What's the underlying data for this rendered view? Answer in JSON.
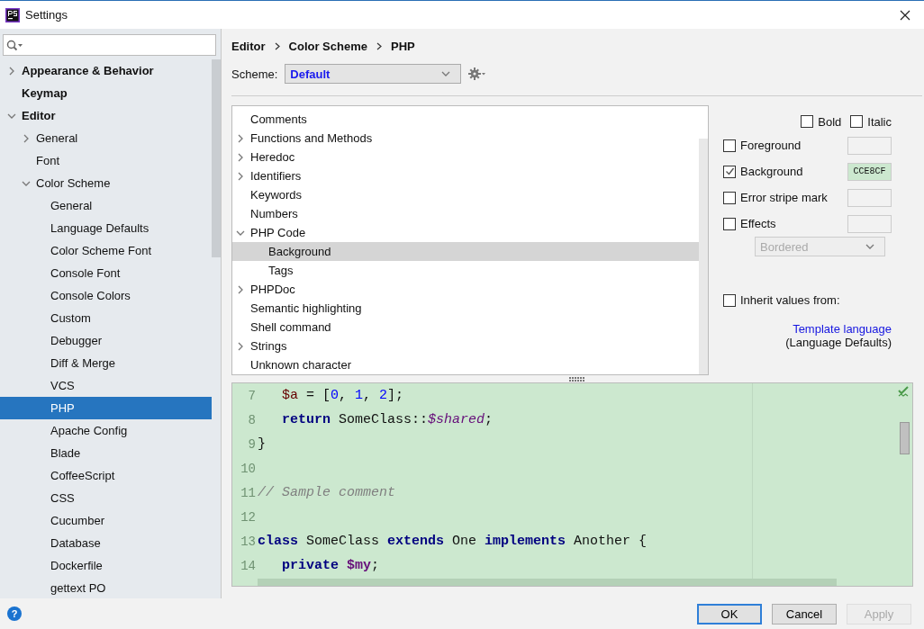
{
  "window": {
    "title": "Settings"
  },
  "sidebar": {
    "items": [
      {
        "label": "Appearance & Behavior",
        "expanded": false,
        "selected": false
      },
      {
        "label": "Keymap",
        "selected": false
      },
      {
        "label": "Editor",
        "expanded": true,
        "selected": false,
        "children": [
          {
            "label": "General",
            "expanded": false,
            "selected": false
          },
          {
            "label": "Font",
            "selected": false
          },
          {
            "label": "Color Scheme",
            "expanded": true,
            "selected": false,
            "children": [
              {
                "label": "General",
                "selected": false
              },
              {
                "label": "Language Defaults",
                "selected": false
              },
              {
                "label": "Color Scheme Font",
                "selected": false
              },
              {
                "label": "Console Font",
                "selected": false
              },
              {
                "label": "Console Colors",
                "selected": false
              },
              {
                "label": "Custom",
                "selected": false
              },
              {
                "label": "Debugger",
                "selected": false
              },
              {
                "label": "Diff & Merge",
                "selected": false
              },
              {
                "label": "VCS",
                "selected": false
              },
              {
                "label": "PHP",
                "selected": true
              },
              {
                "label": "Apache Config",
                "selected": false
              },
              {
                "label": "Blade",
                "selected": false
              },
              {
                "label": "CoffeeScript",
                "selected": false
              },
              {
                "label": "CSS",
                "selected": false
              },
              {
                "label": "Cucumber",
                "selected": false
              },
              {
                "label": "Database",
                "selected": false
              },
              {
                "label": "Dockerfile",
                "selected": false
              },
              {
                "label": "gettext PO",
                "selected": false
              }
            ]
          }
        ]
      }
    ]
  },
  "breadcrumb": [
    "Editor",
    "Color Scheme",
    "PHP"
  ],
  "scheme": {
    "label": "Scheme:",
    "value": "Default"
  },
  "attributes": [
    {
      "label": "Comments",
      "selected": false
    },
    {
      "label": "Functions and Methods",
      "expanded": false,
      "selected": false
    },
    {
      "label": "Heredoc",
      "expanded": false,
      "selected": false
    },
    {
      "label": "Identifiers",
      "expanded": false,
      "selected": false
    },
    {
      "label": "Keywords",
      "selected": false
    },
    {
      "label": "Numbers",
      "selected": false
    },
    {
      "label": "PHP Code",
      "expanded": true,
      "selected": false,
      "children": [
        {
          "label": "Background",
          "selected": true
        },
        {
          "label": "Tags",
          "selected": false
        }
      ]
    },
    {
      "label": "PHPDoc",
      "expanded": false,
      "selected": false
    },
    {
      "label": "Semantic highlighting",
      "selected": false
    },
    {
      "label": "Shell command",
      "selected": false
    },
    {
      "label": "Strings",
      "expanded": false,
      "selected": false
    },
    {
      "label": "Unknown character",
      "selected": false
    }
  ],
  "font_options": [
    {
      "label": "Bold",
      "checked": false
    },
    {
      "label": "Italic",
      "checked": false
    }
  ],
  "color_options": [
    {
      "label": "Foreground",
      "checked": false
    },
    {
      "label": "Background",
      "checked": true,
      "value": "CCE8CF",
      "color": "#cce8cf"
    },
    {
      "label": "Error stripe mark",
      "checked": false
    },
    {
      "label": "Effects",
      "checked": false
    }
  ],
  "effect_type": {
    "value": "Bordered",
    "disabled": true
  },
  "inherit": {
    "label": "Inherit values from:",
    "checked": false,
    "link": "Template language",
    "note": "(Language Defaults)"
  },
  "preview": {
    "lines": [
      {
        "number": "7",
        "indented": true,
        "tokens": [
          {
            "kind": "var",
            "text": "$a"
          },
          {
            "kind": "plain",
            "text": " = ["
          },
          {
            "kind": "num",
            "text": "0"
          },
          {
            "kind": "plain",
            "text": ", "
          },
          {
            "kind": "num",
            "text": "1"
          },
          {
            "kind": "plain",
            "text": ", "
          },
          {
            "kind": "num",
            "text": "2"
          },
          {
            "kind": "plain",
            "text": "];"
          }
        ]
      },
      {
        "number": "8",
        "indented": true,
        "tokens": [
          {
            "kind": "keyword",
            "text": "return"
          },
          {
            "kind": "plain",
            "text": " SomeClass::"
          },
          {
            "kind": "static",
            "text": "$shared"
          },
          {
            "kind": "plain",
            "text": ";"
          }
        ]
      },
      {
        "number": "9",
        "tokens": [
          {
            "kind": "plain",
            "text": "}"
          }
        ]
      },
      {
        "number": "10"
      },
      {
        "number": "11",
        "tokens": [
          {
            "kind": "comment",
            "text": "// Sample comment"
          }
        ]
      },
      {
        "number": "12"
      },
      {
        "number": "13",
        "tokens": [
          {
            "kind": "keyword",
            "text": "class"
          },
          {
            "kind": "plain",
            "text": " SomeClass "
          },
          {
            "kind": "keyword",
            "text": "extends"
          },
          {
            "kind": "plain",
            "text": " One "
          },
          {
            "kind": "keyword",
            "text": "implements"
          },
          {
            "kind": "plain",
            "text": " Another {"
          }
        ]
      },
      {
        "number": "14",
        "indented": true,
        "tokens": [
          {
            "kind": "keyword",
            "text": "private"
          },
          {
            "kind": "field",
            "text": "$my"
          },
          {
            "kind": "plain",
            "text": ";"
          }
        ]
      }
    ]
  },
  "buttons": [
    {
      "label": "OK",
      "kind": "default",
      "disabled": false
    },
    {
      "label": "Cancel",
      "kind": "normal",
      "disabled": false
    },
    {
      "label": "Apply",
      "kind": "normal",
      "disabled": true
    }
  ],
  "help": {
    "label": "?"
  }
}
